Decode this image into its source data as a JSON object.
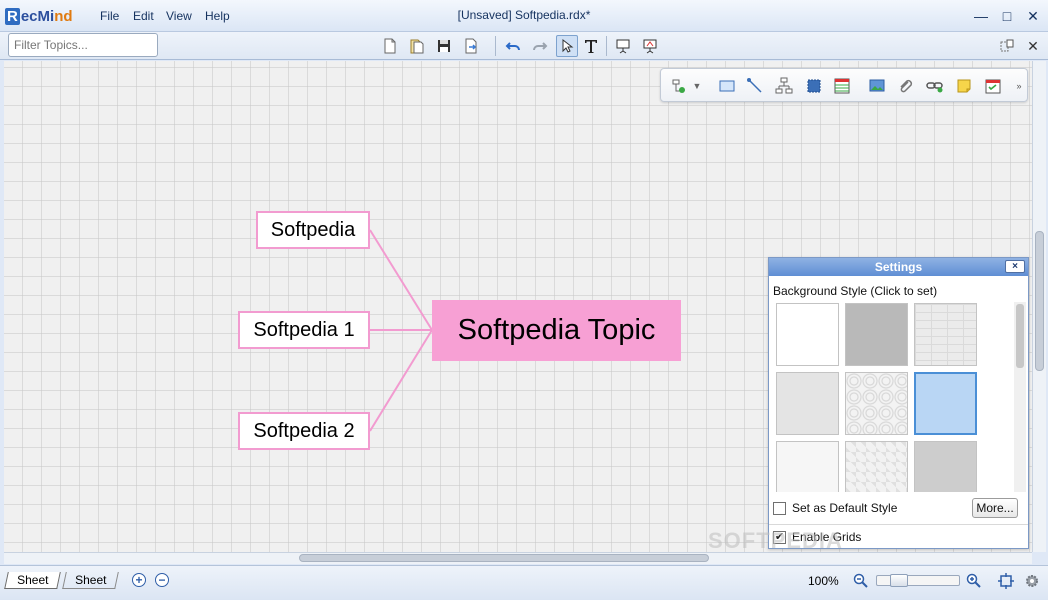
{
  "app": {
    "logo_prefix": "R",
    "logo_mid": "ecMi",
    "logo_suffix": "nd",
    "window_title": "[Unsaved] Softpedia.rdx*"
  },
  "menu": [
    "File",
    "Edit",
    "View",
    "Help"
  ],
  "window_controls": {
    "minimize": "—",
    "maximize": "□",
    "close": "✕"
  },
  "filter": {
    "placeholder": "Filter Topics..."
  },
  "toolbar_close": "✕",
  "map": {
    "central": "Softpedia Topic",
    "topics": [
      "Softpedia",
      "Softpedia 1",
      "Softpedia 2"
    ],
    "branch_color": "#f29bd0",
    "central_color": "#f7a0d4"
  },
  "settings": {
    "title": "Settings",
    "close": "×",
    "background_label": "Background Style (Click to set)",
    "selected_swatch": 5,
    "set_default_label": "Set as Default Style",
    "set_default_checked": false,
    "more_label": "More...",
    "enable_grids_label": "Enable Grids",
    "enable_grids_checked": true,
    "check_mark": "✔"
  },
  "watermark": "SOFTPEDIA",
  "sheets": [
    "Sheet",
    "Sheet"
  ],
  "sheet_add": "+",
  "sheet_remove": "−",
  "status": {
    "zoom_label": "100%",
    "zoom_fraction": 0.2
  }
}
